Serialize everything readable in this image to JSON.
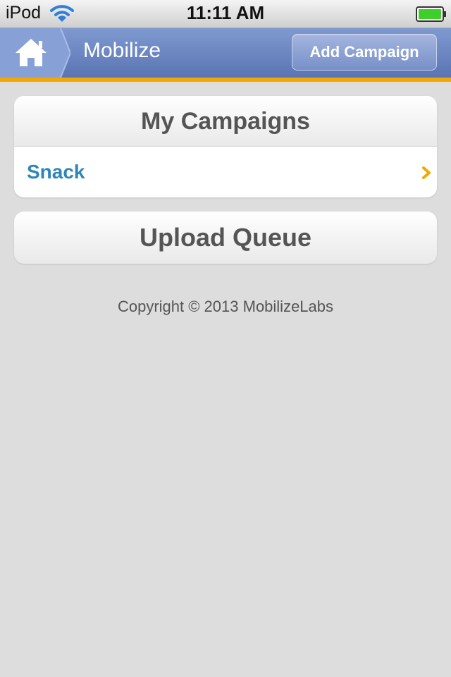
{
  "status_bar": {
    "device": "iPod",
    "time": "11:11 AM",
    "battery_color": "#3fcf2a"
  },
  "header": {
    "title": "Mobilize",
    "add_campaign_label": "Add Campaign",
    "accent_color": "#f3a800",
    "bar_color": "#6781c0"
  },
  "campaigns": {
    "heading": "My Campaigns",
    "items": [
      {
        "label": "Snack"
      }
    ]
  },
  "upload_queue": {
    "label": "Upload Queue"
  },
  "footer": {
    "copyright": "Copyright © 2013 MobilizeLabs"
  }
}
